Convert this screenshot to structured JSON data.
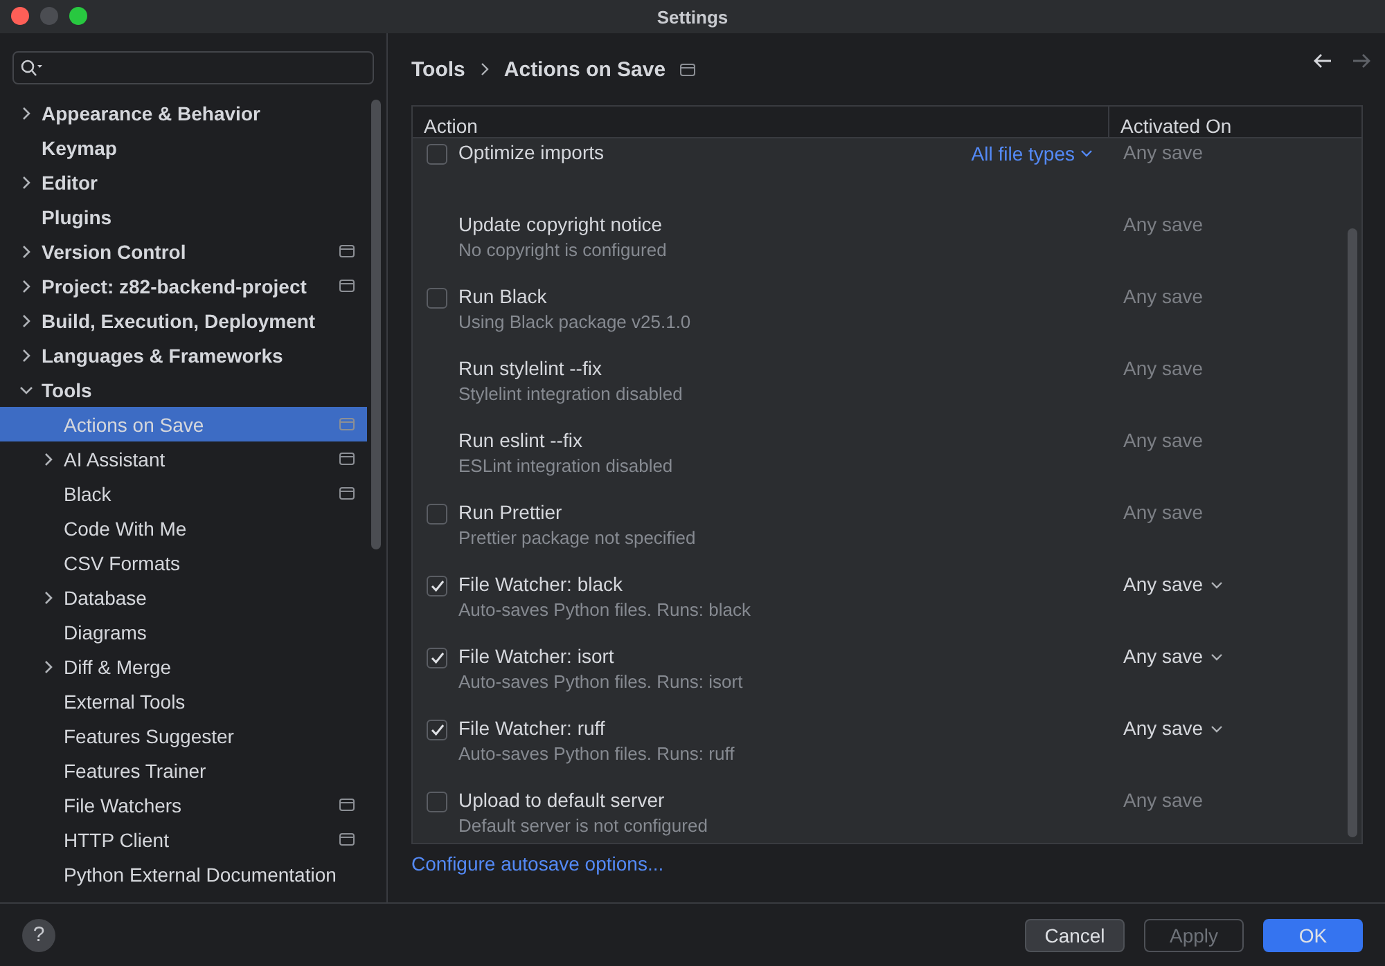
{
  "window": {
    "title": "Settings"
  },
  "sidebar": {
    "items": [
      {
        "label": "Appearance & Behavior",
        "expanded": false,
        "selected": false
      },
      {
        "label": "Keymap",
        "selected": false
      },
      {
        "label": "Editor",
        "expanded": false,
        "selected": false
      },
      {
        "label": "Plugins",
        "selected": false
      },
      {
        "label": "Version Control",
        "expanded": false,
        "project_scope": true,
        "selected": false
      },
      {
        "label": "Project: z82-backend-project",
        "expanded": false,
        "project_scope": true,
        "selected": false
      },
      {
        "label": "Build, Execution, Deployment",
        "expanded": false,
        "selected": false
      },
      {
        "label": "Languages & Frameworks",
        "expanded": false,
        "selected": false
      },
      {
        "label": "Tools",
        "expanded": true,
        "selected": false,
        "children": [
          {
            "label": "Actions on Save",
            "project_scope": true,
            "selected": true
          },
          {
            "label": "AI Assistant",
            "expanded": false,
            "project_scope": true,
            "selected": false
          },
          {
            "label": "Black",
            "project_scope": true,
            "selected": false
          },
          {
            "label": "Code With Me",
            "selected": false
          },
          {
            "label": "CSV Formats",
            "selected": false
          },
          {
            "label": "Database",
            "expanded": false,
            "selected": false
          },
          {
            "label": "Diagrams",
            "selected": false
          },
          {
            "label": "Diff & Merge",
            "expanded": false,
            "selected": false
          },
          {
            "label": "External Tools",
            "selected": false
          },
          {
            "label": "Features Suggester",
            "selected": false
          },
          {
            "label": "Features Trainer",
            "selected": false
          },
          {
            "label": "File Watchers",
            "project_scope": true,
            "selected": false
          },
          {
            "label": "HTTP Client",
            "project_scope": true,
            "selected": false
          },
          {
            "label": "Python External Documentation",
            "selected": false
          }
        ]
      }
    ]
  },
  "breadcrumb": [
    "Tools",
    "Actions on Save"
  ],
  "table": {
    "columns": [
      "Action",
      "Activated On"
    ],
    "rows": [
      {
        "kind": "checkbox",
        "checked": false,
        "name": "Optimize imports",
        "scope": "All file types",
        "activated_on": "Any save",
        "activated_enabled": false
      },
      {
        "kind": "plain",
        "name": "Update copyright notice",
        "detail": "No copyright is configured",
        "activated_on": "Any save",
        "activated_enabled": false
      },
      {
        "kind": "checkbox",
        "checked": false,
        "name": "Run Black",
        "detail": "Using Black package v25.1.0",
        "activated_on": "Any save",
        "activated_enabled": false
      },
      {
        "kind": "plain",
        "name": "Run stylelint --fix",
        "detail": "Stylelint integration disabled",
        "activated_on": "Any save",
        "activated_enabled": false
      },
      {
        "kind": "plain",
        "name": "Run eslint --fix",
        "detail": "ESLint integration disabled",
        "activated_on": "Any save",
        "activated_enabled": false
      },
      {
        "kind": "checkbox",
        "checked": false,
        "name": "Run Prettier",
        "detail": "Prettier package not specified",
        "activated_on": "Any save",
        "activated_enabled": false
      },
      {
        "kind": "checkbox",
        "checked": true,
        "name": "File Watcher: black",
        "detail": "Auto-saves Python files. Runs: black",
        "activated_on": "Any save",
        "activated_enabled": true
      },
      {
        "kind": "checkbox",
        "checked": true,
        "name": "File Watcher: isort",
        "detail": "Auto-saves Python files. Runs: isort",
        "activated_on": "Any save",
        "activated_enabled": true
      },
      {
        "kind": "checkbox",
        "checked": true,
        "name": "File Watcher: ruff",
        "detail": "Auto-saves Python files. Runs: ruff",
        "activated_on": "Any save",
        "activated_enabled": true
      },
      {
        "kind": "checkbox",
        "checked": false,
        "name": "Upload to default server",
        "detail": "Default server is not configured",
        "activated_on": "Any save",
        "activated_enabled": false
      }
    ]
  },
  "link": "Configure autosave options...",
  "help": "?",
  "buttons": [
    {
      "label": "Cancel",
      "kind": "secondary"
    },
    {
      "label": "Apply",
      "kind": "disabled"
    },
    {
      "label": "OK",
      "kind": "primary"
    }
  ]
}
